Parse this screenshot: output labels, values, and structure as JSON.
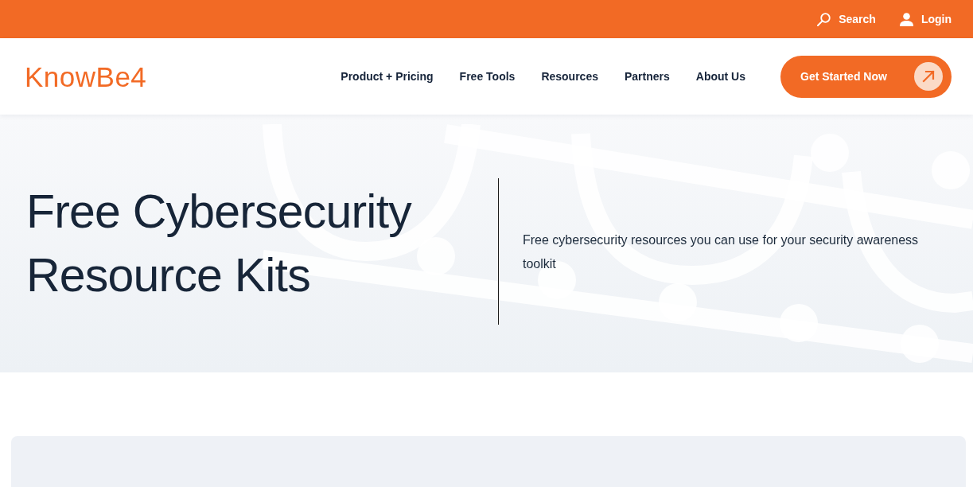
{
  "top_bar": {
    "links": [
      {
        "kind": "search",
        "label": "Search"
      },
      {
        "kind": "login",
        "label": "Login"
      }
    ]
  },
  "header": {
    "logo": "KnowBe4",
    "nav": [
      {
        "label": "Product + Pricing"
      },
      {
        "label": "Free Tools"
      },
      {
        "label": "Resources"
      },
      {
        "label": "Partners"
      },
      {
        "label": "About Us"
      }
    ],
    "cta": {
      "label": "Get Started Now"
    }
  },
  "hero": {
    "title": "Free Cybersecurity Resource Kits",
    "description": "Free cybersecurity resources you can use for your security awareness toolkit"
  }
}
